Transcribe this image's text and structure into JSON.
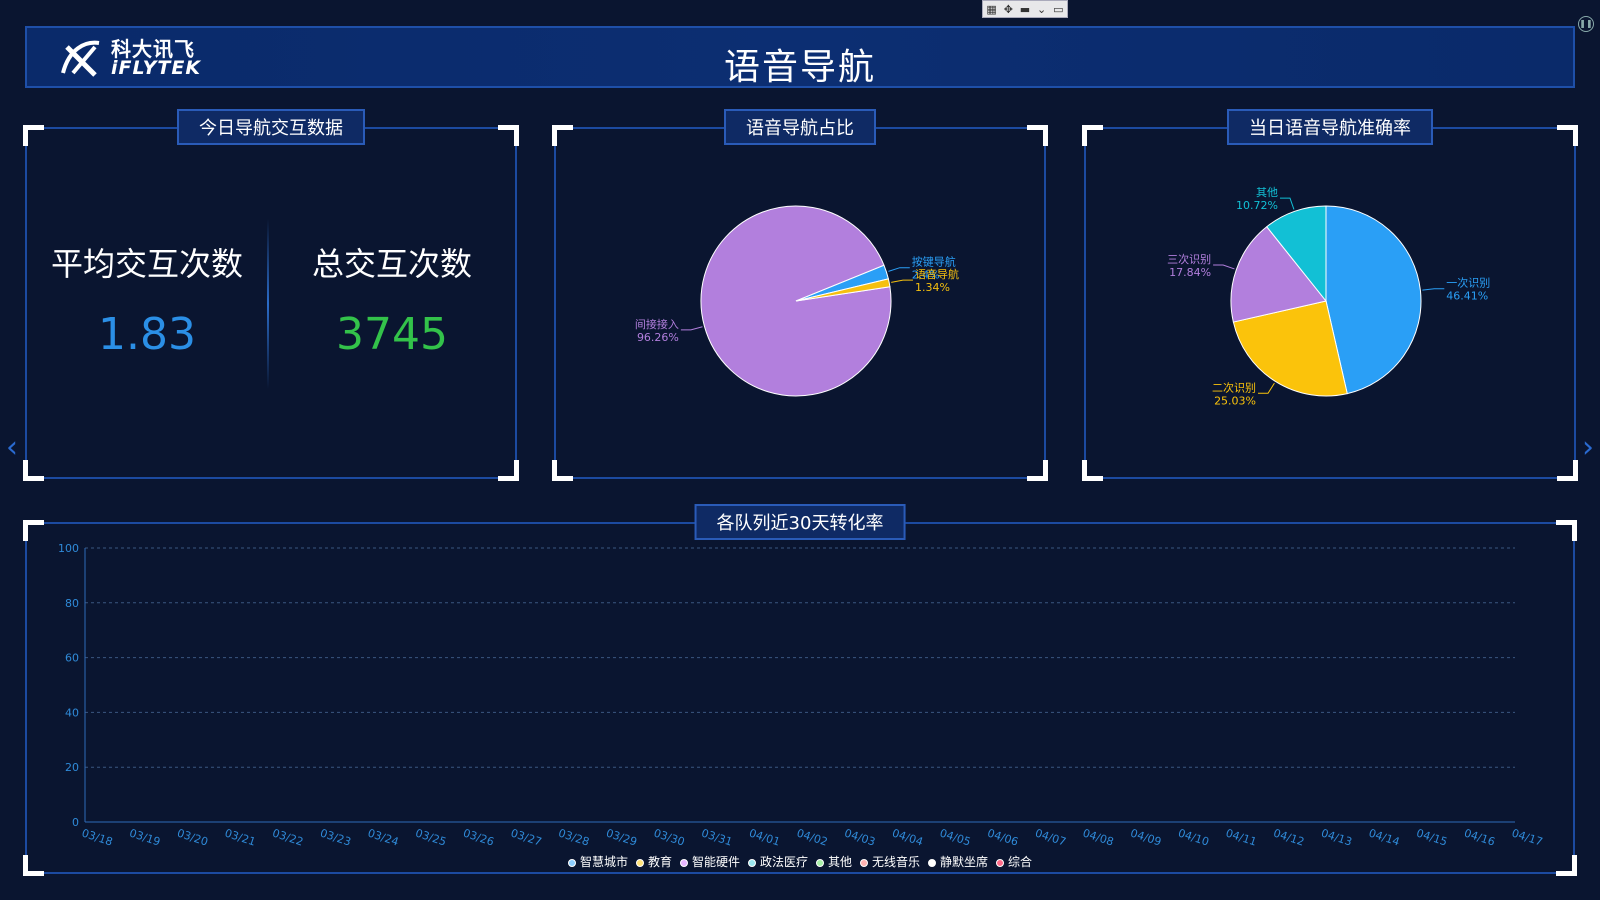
{
  "header": {
    "logo_cn": "科大讯飞",
    "logo_en": "iFLYTEK",
    "title": "语音导航"
  },
  "panel1": {
    "title": "今日导航交互数据",
    "stats": [
      {
        "label": "平均交互次数",
        "value": "1.83",
        "color": "#2b8fe6"
      },
      {
        "label": "总交互次数",
        "value": "3745",
        "color": "#33c24a"
      }
    ]
  },
  "panel2": {
    "title": "语音导航占比"
  },
  "panel3": {
    "title": "当日语音导航准确率"
  },
  "panel4": {
    "title": "各队列近30天转化率"
  },
  "chart_data": [
    {
      "type": "pie",
      "slices": [
        {
          "name": "间接接入",
          "percent": "96.26%",
          "value": 96.26,
          "color": "#b27fdd"
        },
        {
          "name": "按键导航",
          "percent": "2.4%",
          "value": 2.4,
          "color": "#2a9ff6"
        },
        {
          "name": "语音导航",
          "percent": "1.34%",
          "value": 1.34,
          "color": "#f5c00f"
        }
      ]
    },
    {
      "type": "pie",
      "slices": [
        {
          "name": "一次识别",
          "percent": "46.41%",
          "value": 46.41,
          "color": "#2a9ff6"
        },
        {
          "name": "二次识别",
          "percent": "25.03%",
          "value": 25.03,
          "color": "#fbc30b"
        },
        {
          "name": "三次识别",
          "percent": "17.84%",
          "value": 17.84,
          "color": "#b27fdd"
        },
        {
          "name": "其他",
          "percent": "10.72%",
          "value": 10.72,
          "color": "#12c0d5"
        }
      ]
    },
    {
      "type": "line",
      "ylim": [
        0,
        100
      ],
      "yticks": [
        "0",
        "20",
        "40",
        "60",
        "80",
        "100"
      ],
      "grid": true,
      "legend_position": "bottom",
      "x": [
        "03/18",
        "03/19",
        "03/20",
        "03/21",
        "03/22",
        "03/23",
        "03/24",
        "03/25",
        "03/26",
        "03/27",
        "03/28",
        "03/29",
        "03/30",
        "03/31",
        "04/01",
        "04/02",
        "04/03",
        "04/04",
        "04/05",
        "04/06",
        "04/07",
        "04/08",
        "04/09",
        "04/10",
        "04/11",
        "04/12",
        "04/13",
        "04/14",
        "04/15",
        "04/16",
        "04/17"
      ],
      "series": [
        {
          "name": "智慧城市",
          "color": "#8ecfff"
        },
        {
          "name": "教育",
          "color": "#ffe27a"
        },
        {
          "name": "智能硬件",
          "color": "#e6b6ff"
        },
        {
          "name": "政法医疗",
          "color": "#9be8f0"
        },
        {
          "name": "其他",
          "color": "#a8f0a8"
        },
        {
          "name": "无线音乐",
          "color": "#ffb3b3"
        },
        {
          "name": "静默坐席",
          "color": "#ffffff"
        },
        {
          "name": "综合",
          "color": "#ff6b8a"
        }
      ]
    }
  ]
}
